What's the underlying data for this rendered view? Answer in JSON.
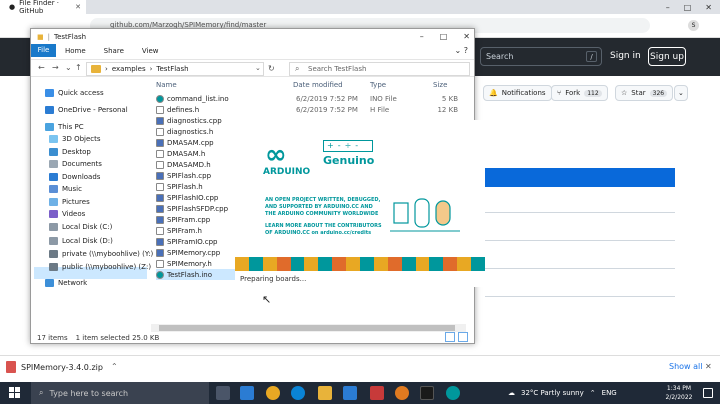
{
  "browser": {
    "tab_title": "File Finder · GitHub",
    "address": "github.com/Marzogh/SPIMemory/find/master",
    "avatar_letter": "S",
    "window_controls": [
      "–",
      "□",
      "✕"
    ]
  },
  "github": {
    "search_placeholder": "Search",
    "search_shortcut": "/",
    "sign_in": "Sign in",
    "sign_up": "Sign up",
    "notifications": "Notifications",
    "fork_label": "Fork",
    "fork_count": "112",
    "star_label": "Star",
    "star_count": "326"
  },
  "explorer": {
    "title": "TestFlash",
    "ribbon": {
      "file": "File",
      "tabs": [
        "Home",
        "Share",
        "View"
      ]
    },
    "breadcrumb": [
      "examples",
      "TestFlash"
    ],
    "search_placeholder": "Search TestFlash",
    "nav": {
      "quick_access": "Quick access",
      "onedrive": "OneDrive - Personal",
      "this_pc": "This PC",
      "objects3d": "3D Objects",
      "desktop": "Desktop",
      "documents": "Documents",
      "downloads": "Downloads",
      "music": "Music",
      "pictures": "Pictures",
      "videos": "Videos",
      "local_c": "Local Disk (C:)",
      "local_d": "Local Disk (D:)",
      "private_y": "private (\\\\myboohlive) (Y:)",
      "public_z": "public (\\\\myboohlive) (Z:)",
      "network": "Network"
    },
    "columns": {
      "name": "Name",
      "date": "Date modified",
      "type": "Type",
      "size": "Size"
    },
    "files": [
      {
        "name": "command_list.ino",
        "date": "6/2/2019 7:52 PM",
        "type": "INO File",
        "size": "5 KB",
        "icon": "arduino"
      },
      {
        "name": "defines.h",
        "date": "6/2/2019 7:52 PM",
        "type": "H File",
        "size": "12 KB",
        "icon": "file"
      },
      {
        "name": "diagnostics.cpp",
        "date": "",
        "type": "",
        "size": "",
        "icon": "cpp"
      },
      {
        "name": "diagnostics.h",
        "date": "",
        "type": "",
        "size": "",
        "icon": "file"
      },
      {
        "name": "DMASAM.cpp",
        "date": "",
        "type": "",
        "size": "",
        "icon": "cpp"
      },
      {
        "name": "DMASAM.h",
        "date": "",
        "type": "",
        "size": "",
        "icon": "file"
      },
      {
        "name": "DMASAMD.h",
        "date": "",
        "type": "",
        "size": "",
        "icon": "file"
      },
      {
        "name": "SPIFlash.cpp",
        "date": "",
        "type": "",
        "size": "",
        "icon": "cpp"
      },
      {
        "name": "SPIFlash.h",
        "date": "",
        "type": "",
        "size": "",
        "icon": "file"
      },
      {
        "name": "SPIFlashIO.cpp",
        "date": "",
        "type": "",
        "size": "",
        "icon": "cpp"
      },
      {
        "name": "SPIFlashSFDP.cpp",
        "date": "",
        "type": "",
        "size": "",
        "icon": "cpp"
      },
      {
        "name": "SPIFram.cpp",
        "date": "",
        "type": "",
        "size": "",
        "icon": "cpp"
      },
      {
        "name": "SPIFram.h",
        "date": "",
        "type": "",
        "size": "",
        "icon": "file"
      },
      {
        "name": "SPIFramIO.cpp",
        "date": "",
        "type": "",
        "size": "",
        "icon": "cpp"
      },
      {
        "name": "SPIMemory.cpp",
        "date": "",
        "type": "",
        "size": "",
        "icon": "cpp"
      },
      {
        "name": "SPIMemory.h",
        "date": "",
        "type": "",
        "size": "",
        "icon": "file"
      },
      {
        "name": "TestFlash.ino",
        "date": "",
        "type": "",
        "size": "",
        "icon": "arduino"
      }
    ],
    "status": {
      "count": "17 items",
      "selection": "1 item selected 25.0 KB"
    }
  },
  "splash": {
    "brand": "ARDUINO",
    "genuino": "Genuino",
    "symbols": "+-÷-",
    "line1": "AN OPEN PROJECT WRITTEN, DEBUGGED,",
    "line2": "AND SUPPORTED BY ARDUINO.CC AND",
    "line3": "THE ARDUINO COMMUNITY WORLDWIDE",
    "line4": "LEARN MORE ABOUT THE CONTRIBUTORS",
    "line5": "OF ARDUINO.CC on arduino.cc/credits",
    "status": "Preparing boards..."
  },
  "downloads": {
    "file": "SPIMemory-3.4.0.zip",
    "show_all": "Show all"
  },
  "taskbar": {
    "search_placeholder": "Type here to search",
    "weather": "32°C  Partly sunny",
    "lang": "ENG",
    "time": "1:34 PM",
    "date": "2/2/2022"
  },
  "colors": {
    "accent": "#00979c",
    "gh_dark": "#24292f",
    "select": "#cce8ff",
    "gh_blue": "#0969da"
  }
}
